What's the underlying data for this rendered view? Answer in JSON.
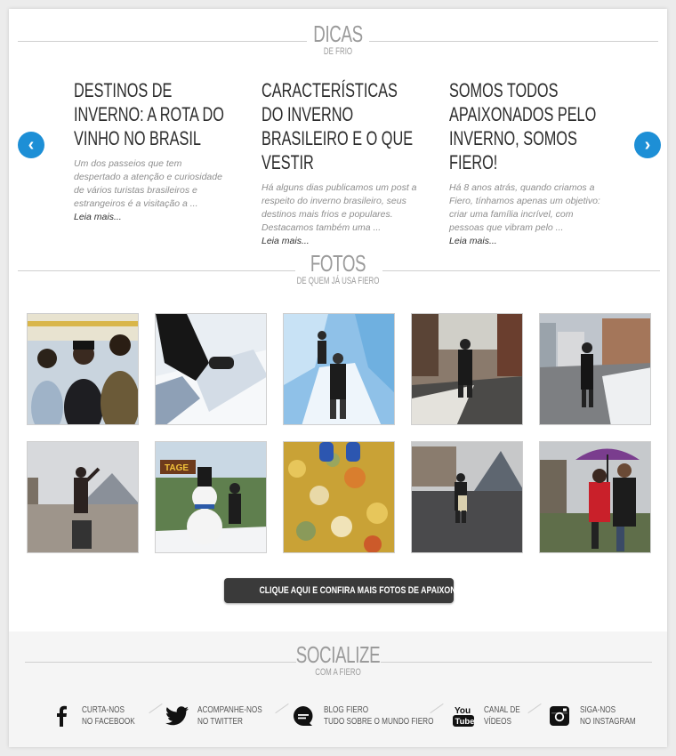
{
  "tips": {
    "heading": "DICAS",
    "subheading": "DE FRIO",
    "prev_icon": "chevron-left-icon",
    "next_icon": "chevron-right-icon",
    "items": [
      {
        "title": "DESTINOS DE INVERNO: A ROTA DO VINHO NO BRASIL",
        "excerpt": "Um dos passeios que tem despertado a atenção e curiosidade de vários turistas brasileiros e estrangeiros é a visitação a ...",
        "more": "Leia mais..."
      },
      {
        "title": "CARACTERÍSTICAS DO INVERNO BRASILEIRO E O QUE VESTIR",
        "excerpt": "Há alguns dias publicamos um post a respeito do inverno brasileiro, seus destinos mais frios e populares. Destacamos também uma ...",
        "more": "Leia mais..."
      },
      {
        "title": "SOMOS TODOS APAIXONADOS PELO INVERNO, SOMOS FIERO!",
        "excerpt": "Há 8 anos atrás, quando criamos a Fiero, tínhamos apenas um objetivo: criar uma família incrível, com pessoas que vibram pelo ...",
        "more": "Leia mais..."
      }
    ]
  },
  "photos": {
    "heading": "FOTOS",
    "subheading": "DE QUEM JÁ USA FIERO",
    "cta_label": "CLIQUE AQUI E CONFIRA MAIS FOTOS DE APAIXONADOS PELO INVERNO"
  },
  "social": {
    "heading": "SOCIALIZE",
    "subheading": "COM A FIERO",
    "items": [
      {
        "icon": "facebook-icon",
        "line1": "CURTA-NOS",
        "line2": "NO FACEBOOK"
      },
      {
        "icon": "twitter-icon",
        "line1": "ACOMPANHE-NOS",
        "line2": "NO TWITTER"
      },
      {
        "icon": "blog-icon",
        "line1": "BLOG FIERO",
        "line2": "TUDO SOBRE O MUNDO FIERO"
      },
      {
        "icon": "youtube-icon",
        "line1": "CANAL DE",
        "line2": "VÍDEOS"
      },
      {
        "icon": "instagram-icon",
        "line1": "SIGA-NOS",
        "line2": "NO INSTAGRAM"
      }
    ]
  },
  "colors": {
    "accent": "#1d8fd6",
    "heading_gray": "#9b9b9b",
    "cta_bg": "#3a3a3a"
  }
}
